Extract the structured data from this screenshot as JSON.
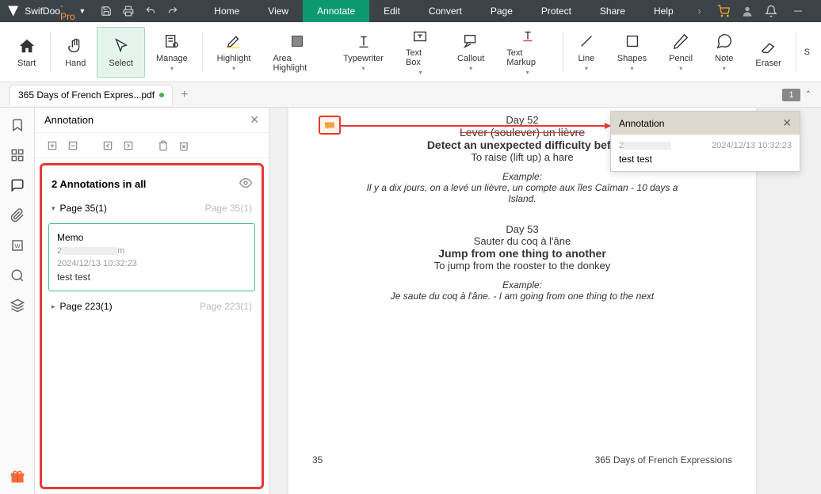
{
  "app": {
    "name_prefix": "SwifDoo",
    "name_suffix": "-Pro"
  },
  "menus": [
    "Home",
    "View",
    "Annotate",
    "Edit",
    "Convert",
    "Page",
    "Protect",
    "Share",
    "Help"
  ],
  "active_menu": "Annotate",
  "ribbon": {
    "start": "Start",
    "hand": "Hand",
    "select": "Select",
    "manage": "Manage",
    "highlight": "Highlight",
    "area_highlight": "Area Highlight",
    "typewriter": "Typewriter",
    "textbox": "Text Box",
    "callout": "Callout",
    "textmarkup": "Text Markup",
    "line": "Line",
    "shapes": "Shapes",
    "pencil": "Pencil",
    "note": "Note",
    "eraser": "Eraser"
  },
  "tab": {
    "filename": "365 Days of French Expres...pdf"
  },
  "page_indicator": "1",
  "anno_panel": {
    "title": "Annotation",
    "count_label": "2 Annotations in all",
    "pages": [
      {
        "label": "Page 35(1)",
        "right": "Page 35(1)"
      },
      {
        "label": "Page 223(1)",
        "right": "Page 223(1)"
      }
    ],
    "memo": {
      "type": "Memo",
      "user_prefix": "2",
      "user_suffix": "m",
      "date": "2024/12/13 10:32:23",
      "text": "test test"
    }
  },
  "popup": {
    "title": "Annotation",
    "user_prefix": "2",
    "date": "2024/12/13 10:32:23",
    "text": "test test"
  },
  "doc": {
    "day52": {
      "num": "Day 52",
      "fr": "Lever (soulever) un lièvre",
      "en": "Detect an unexpected difficulty befo",
      "lit": "To raise (lift up) a hare",
      "ex_label": "Example:",
      "ex": "Il y a dix jours, on a levé un lièvre, un compte aux îles Caïman - 10 days a",
      "ex2": "Island."
    },
    "day53": {
      "num": "Day 53",
      "fr": "Sauter du coq à l'âne",
      "en": "Jump from one thing to another",
      "lit": "To jump from the rooster to the donkey",
      "ex_label": "Example:",
      "ex": "Je saute du coq à l'âne. - I am going from one thing to the next"
    },
    "footer": {
      "page_num": "35",
      "title": "365 Days of French Expressions"
    }
  }
}
